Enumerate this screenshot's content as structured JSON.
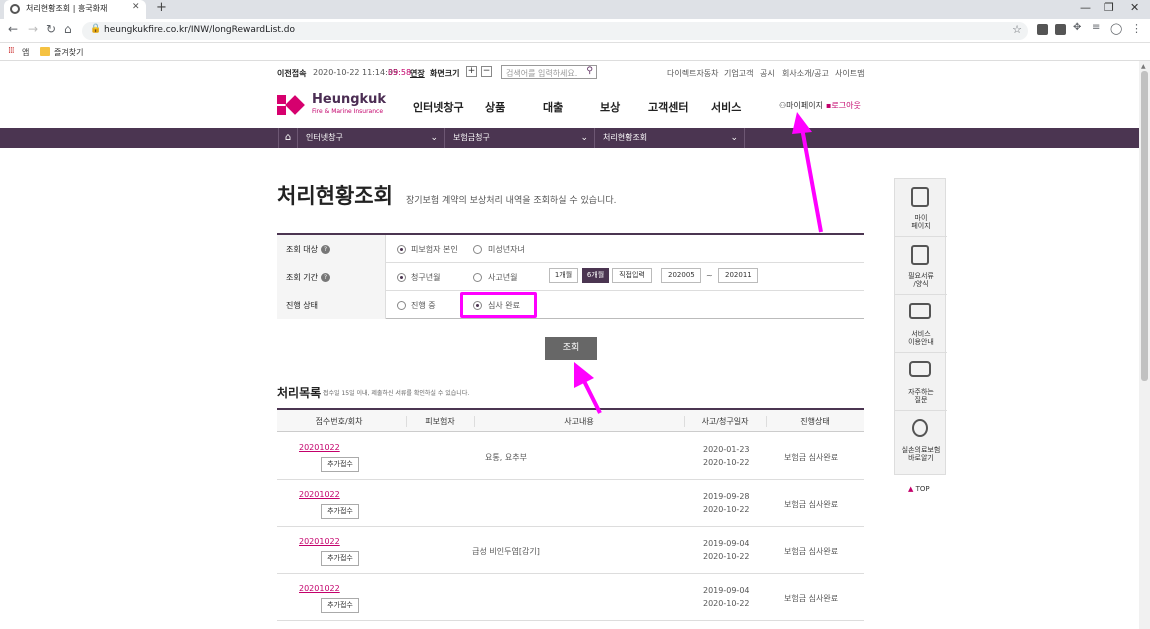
{
  "browser": {
    "tab_title": "처리현황조회 | 흥국화재",
    "url": "heungkukfire.co.kr/INW/longRewardList.do",
    "bookmarks": [
      "앱",
      "즐겨찾기"
    ]
  },
  "utility": {
    "prev_login_label": "이전접속",
    "prev_login_time": "2020-10-22 11:14:35",
    "timer": "09:58",
    "extend": "연장",
    "screen_size_label": "화면크기",
    "zoom_in": "+",
    "zoom_out": "−",
    "search_placeholder": "검색어를 입력하세요.",
    "links": [
      "다이렉트자동차",
      "기업고객",
      "공시",
      "회사소개/공고",
      "사이트맵"
    ]
  },
  "header": {
    "logo_name": "Heungkuk",
    "logo_sub": "Fire & Marine Insurance",
    "nav": [
      "인터넷창구",
      "상품",
      "대출",
      "보상",
      "고객센터",
      "서비스"
    ],
    "mypage": "마이페이지",
    "logout": "로그아웃"
  },
  "breadcrumb": [
    "인터넷창구",
    "보험금청구",
    "처리현황조회"
  ],
  "page": {
    "title": "처리현황조회",
    "description": "장기보험 계약의 보상처리 내역을 조회하실 수 있습니다."
  },
  "filters": {
    "target_label": "조회 대상",
    "target_options": [
      "피보험자 본인",
      "미성년자녀"
    ],
    "period_label": "조회 기간",
    "period_options": [
      "청구년월",
      "사고년월"
    ],
    "period_buttons": [
      "1개월",
      "6개월",
      "직접입력"
    ],
    "date_from": "202005",
    "date_sep": "~",
    "date_to": "202011",
    "status_label": "진행 상태",
    "status_options": [
      "진행 중",
      "심사 완료"
    ],
    "search_button": "조회"
  },
  "list": {
    "title": "처리목록",
    "description": "접수일 15일 이내, 제출하신 서류를 확인하실 수 있습니다.",
    "columns": [
      "접수번호/회차",
      "피보험자",
      "사고내용",
      "사고/청구일자",
      "진행상태"
    ],
    "add_label": "추가접수",
    "rows": [
      {
        "no": "20201022",
        "insured": "",
        "desc": "요통, 요추부",
        "date1": "2020-01-23",
        "date2": "2020-10-22",
        "status": "보험금 심사완료"
      },
      {
        "no": "20201022",
        "insured": "",
        "desc": "",
        "date1": "2019-09-28",
        "date2": "2020-10-22",
        "status": "보험금 심사완료"
      },
      {
        "no": "20201022",
        "insured": "",
        "desc": "급성 비인두염[감기]",
        "date1": "2019-09-04",
        "date2": "2020-10-22",
        "status": "보험금 심사완료"
      },
      {
        "no": "20201022",
        "insured": "",
        "desc": "",
        "date1": "2019-09-04",
        "date2": "2020-10-22",
        "status": "보험금 심사완료"
      }
    ]
  },
  "quick_menu": {
    "items": [
      "마이\n페이지",
      "필요서류\n/양식",
      "서비스\n이용안내",
      "자주하는\n질문",
      "실손의료보험\n바로알기"
    ],
    "top": "TOP"
  },
  "colors": {
    "brand": "#4b3551",
    "accent": "#c3006b",
    "annotation": "#ff00ff"
  }
}
